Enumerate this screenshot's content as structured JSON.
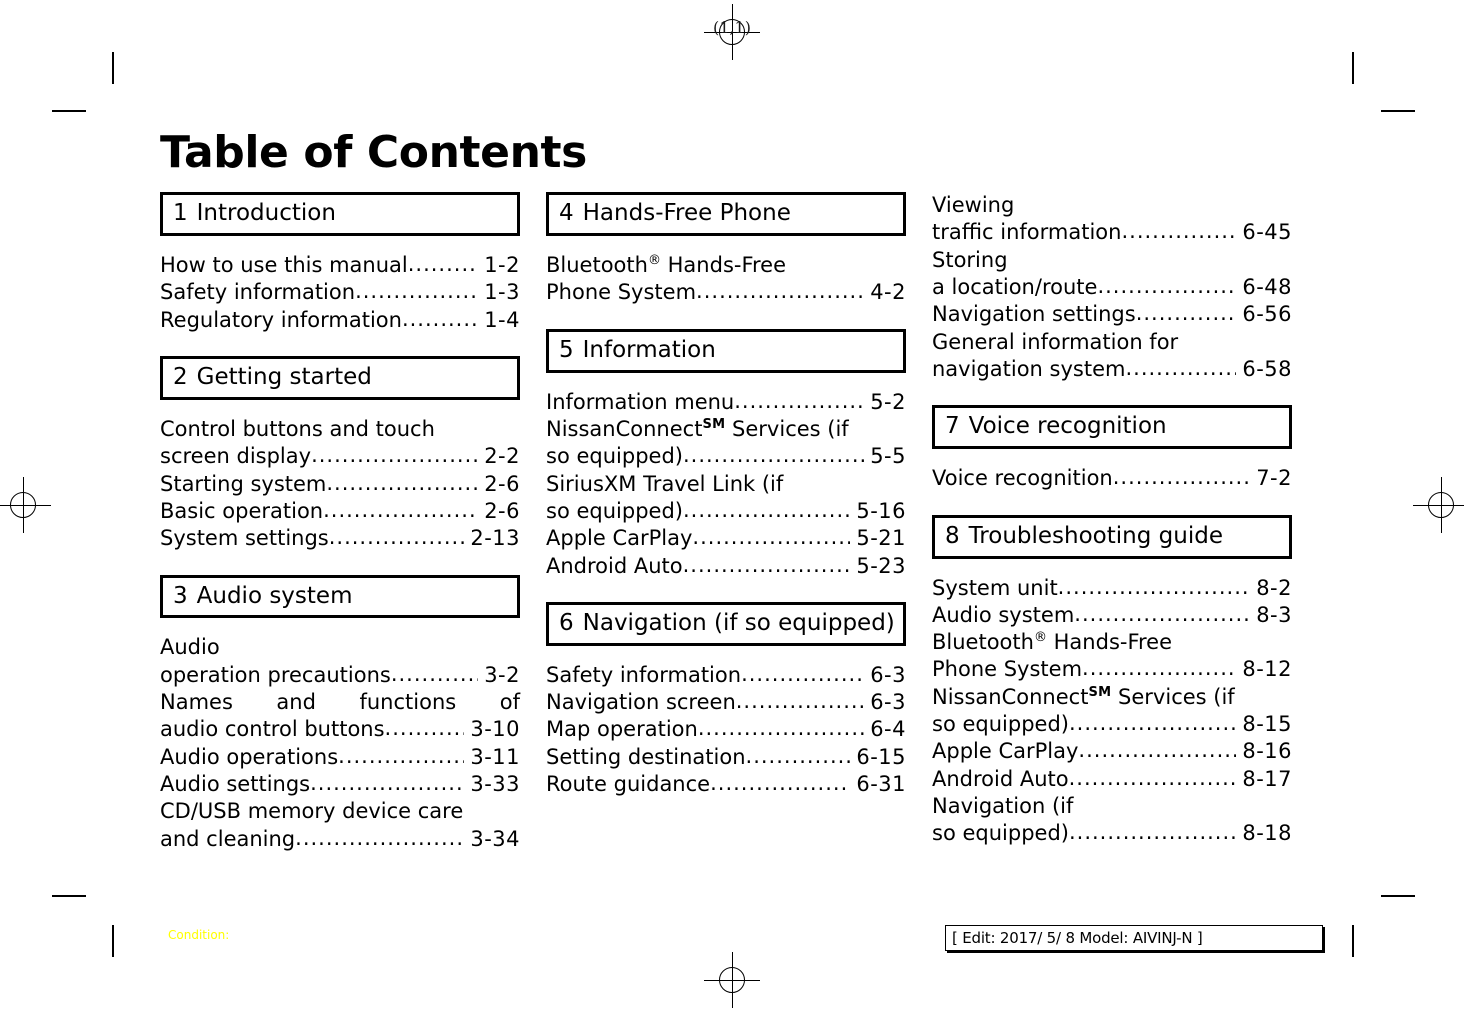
{
  "page": {
    "header_mark": "(1,1)",
    "title": "Table of Contents"
  },
  "columns": [
    {
      "name": "column-left",
      "sections": [
        {
          "number": "1",
          "title": "Introduction",
          "entries": [
            {
              "label": "How to use this manual",
              "page": "1-2"
            },
            {
              "label": "Safety information",
              "page": "1-3"
            },
            {
              "label": "Regulatory information",
              "page": "1-4"
            }
          ]
        },
        {
          "number": "2",
          "title": "Getting started",
          "entries": [
            {
              "pre": "Control buttons and touch",
              "label": "screen display",
              "page": "2-2"
            },
            {
              "label": "Starting system",
              "page": "2-6"
            },
            {
              "label": "Basic operation",
              "page": "2-6"
            },
            {
              "label": "System settings",
              "page": "2-13"
            }
          ]
        },
        {
          "number": "3",
          "title": "Audio system",
          "entries": [
            {
              "pre": "Audio",
              "label": "operation precautions",
              "page": "3-2"
            },
            {
              "pre_justified": "Names and functions of",
              "label": "audio control buttons",
              "page": "3-10"
            },
            {
              "label": "Audio operations",
              "page": "3-11"
            },
            {
              "label": "Audio settings",
              "page": "3-33"
            },
            {
              "pre": "CD/USB memory device care",
              "label": "and cleaning",
              "page": "3-34"
            }
          ]
        }
      ]
    },
    {
      "name": "column-middle",
      "sections": [
        {
          "number": "4",
          "title": "Hands-Free Phone",
          "entries": [
            {
              "pre_html": "Bluetooth<sup class=\"reg-mark\">®</sup> Hands-Free",
              "label": "Phone System",
              "page": "4-2"
            }
          ]
        },
        {
          "number": "5",
          "title": "Information",
          "entries": [
            {
              "label": "Information menu",
              "page": "5-2"
            },
            {
              "pre_html": "NissanConnect<sup class=\"sm\">SM</sup> Services (if",
              "label": "so equipped)",
              "page": "5-5"
            },
            {
              "pre": "SiriusXM Travel Link (if",
              "label": "so equipped)",
              "page": "5-16"
            },
            {
              "label": "Apple CarPlay",
              "page": "5-21"
            },
            {
              "label": "Android Auto",
              "page": "5-23"
            }
          ]
        },
        {
          "number": "6",
          "title": "Navigation (if so equipped)",
          "two_line": true,
          "entries": [
            {
              "label": "Safety information",
              "page": "6-3"
            },
            {
              "label": "Navigation screen",
              "page": "6-3"
            },
            {
              "label": "Map operation",
              "page": "6-4"
            },
            {
              "label": "Setting destination",
              "page": "6-15"
            },
            {
              "label": "Route guidance",
              "page": "6-31"
            }
          ]
        }
      ]
    },
    {
      "name": "column-right",
      "sections": [
        {
          "number": "",
          "title": "",
          "no_box": true,
          "entries": [
            {
              "pre": "Viewing",
              "label": "traffic information",
              "page": "6-45"
            },
            {
              "pre": "Storing",
              "label": "a location/route",
              "page": "6-48"
            },
            {
              "label": "Navigation settings",
              "page": "6-56"
            },
            {
              "pre": "General information for",
              "label": "navigation system",
              "page": "6-58"
            }
          ]
        },
        {
          "number": "7",
          "title": "Voice recognition",
          "entries": [
            {
              "label": "Voice recognition",
              "page": "7-2"
            }
          ]
        },
        {
          "number": "8",
          "title": "Troubleshooting guide",
          "entries": [
            {
              "label": "System unit",
              "page": "8-2"
            },
            {
              "label": "Audio system",
              "page": "8-3"
            },
            {
              "pre_html": "Bluetooth<sup class=\"reg-mark\">®</sup> Hands-Free",
              "label": "Phone System",
              "page": "8-12"
            },
            {
              "pre_html": "NissanConnect<sup class=\"sm\">SM</sup> Services (if",
              "label": "so equipped)",
              "page": "8-15"
            },
            {
              "label": "Apple CarPlay",
              "page": "8-16"
            },
            {
              "label": "Android Auto",
              "page": "8-17"
            },
            {
              "pre": "Navigation (if",
              "label": "so equipped)",
              "page": "8-18"
            }
          ]
        }
      ]
    }
  ],
  "footer": {
    "condition_label": "Condition:",
    "condition_color": "#ffff00",
    "edit_info": "[ Edit: 2017/ 5/ 8   Model: AIVINJ-N ]"
  }
}
